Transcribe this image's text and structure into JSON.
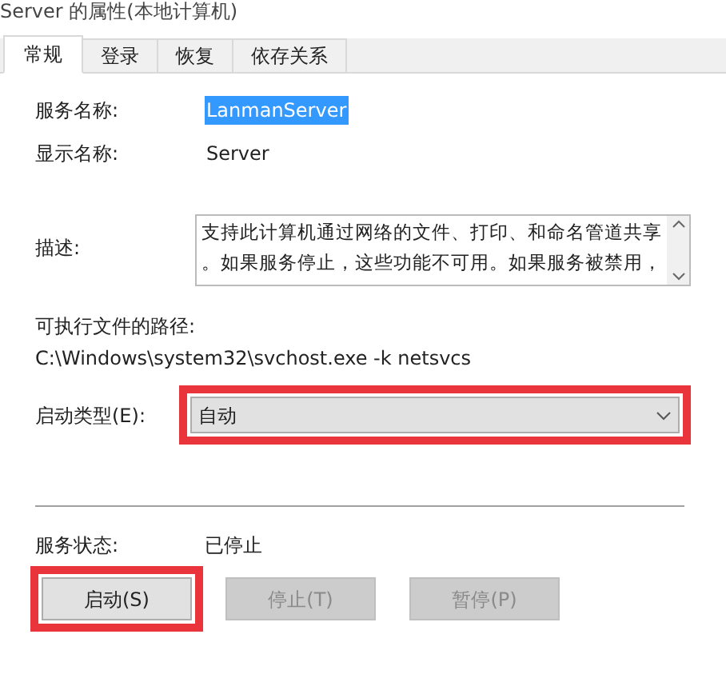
{
  "window": {
    "title": "Server 的属性(本地计算机)"
  },
  "tabs": [
    {
      "label": "常规",
      "selected": true
    },
    {
      "label": "登录",
      "selected": false
    },
    {
      "label": "恢复",
      "selected": false
    },
    {
      "label": "依存关系",
      "selected": false
    }
  ],
  "service_name": {
    "label": "服务名称:",
    "value": "LanmanServer",
    "selected": true
  },
  "display_name": {
    "label": "显示名称:",
    "value": "Server"
  },
  "description": {
    "label": "描述:",
    "lines": [
      "支持此计算机通过网络的文件、打印、和命名管道共享",
      "。如果服务停止，这些功能不可用。如果服务被禁用，"
    ]
  },
  "executable_path": {
    "label": "可执行文件的路径:",
    "value": "C:\\Windows\\system32\\svchost.exe -k netsvcs"
  },
  "startup_type": {
    "label": "启动类型(E):",
    "value": "自动",
    "highlighted": true
  },
  "service_status": {
    "label": "服务状态:",
    "value": "已停止"
  },
  "buttons": [
    {
      "label": "启动(S)",
      "disabled": false,
      "highlighted": true
    },
    {
      "label": "停止(T)",
      "disabled": true,
      "highlighted": false
    },
    {
      "label": "暂停(P)",
      "disabled": true,
      "highlighted": false
    }
  ]
}
